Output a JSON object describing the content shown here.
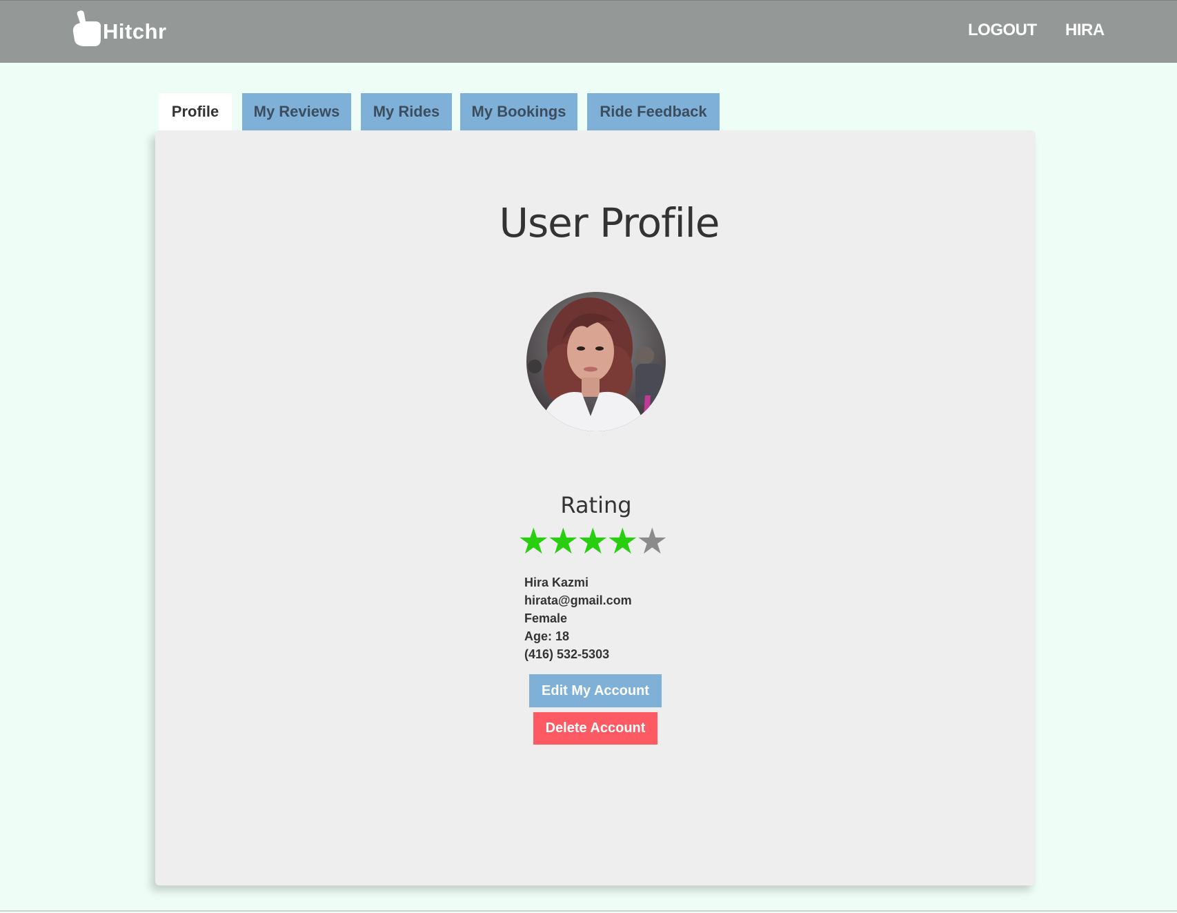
{
  "navbar": {
    "brand": "Hitchr",
    "brand_icon": "thumbs-up-icon",
    "links": {
      "logout": "LOGOUT",
      "user": "HIRA"
    }
  },
  "tabs": [
    {
      "label": "Profile",
      "active": true
    },
    {
      "label": "My Reviews",
      "active": false
    },
    {
      "label": "My Rides",
      "active": false
    },
    {
      "label": "My Bookings",
      "active": false
    },
    {
      "label": "Ride Feedback",
      "active": false
    }
  ],
  "profile": {
    "title": "User Profile",
    "rating_label": "Rating",
    "rating": 4,
    "rating_max": 5,
    "name": "Hira Kazmi",
    "email": "hirata@gmail.com",
    "gender": "Female",
    "age": "Age: 18",
    "phone": "(416) 532-5303"
  },
  "actions": {
    "edit_label": "Edit My Account",
    "delete_label": "Delete Account"
  },
  "colors": {
    "navbar": "#949997",
    "page_background": "#effdf7",
    "tab": "#7fb0d8",
    "card": "#eeeeee",
    "star_filled": "#27cf0f",
    "star_empty": "#8b8b8b",
    "danger": "#fe5a63"
  }
}
